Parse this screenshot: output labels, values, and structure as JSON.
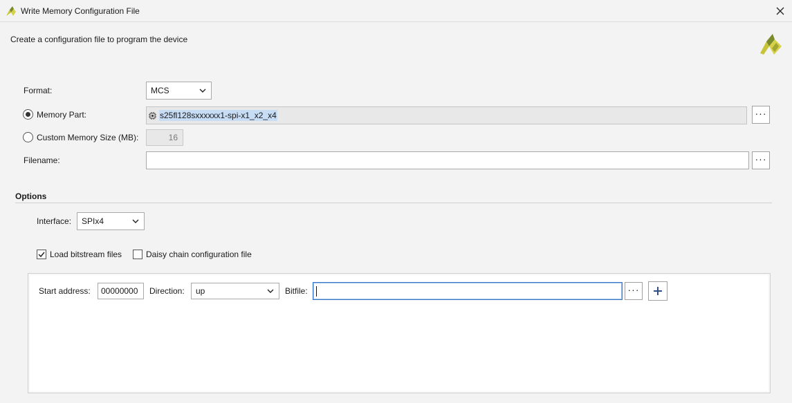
{
  "window": {
    "title": "Write Memory Configuration File",
    "close_icon": "close-icon",
    "app_icon": "vivado-logo-icon"
  },
  "header": {
    "description": "Create a configuration file to program the device",
    "brand_logo": "vivado-logo"
  },
  "form": {
    "format_label": "Format:",
    "format_value": "MCS",
    "memory_part_label": "Memory Part:",
    "memory_part_selected": true,
    "memory_part_value": "s25fl128sxxxxxx1-spi-x1_x2_x4",
    "custom_size_label": "Custom Memory Size (MB):",
    "custom_size_selected": false,
    "custom_size_value": "16",
    "filename_label": "Filename:",
    "filename_value": "",
    "browse_label": "···"
  },
  "options": {
    "section_title": "Options",
    "interface_label": "Interface:",
    "interface_value": "SPIx4",
    "load_bitstream_label": "Load bitstream files",
    "load_bitstream_checked": true,
    "daisy_chain_label": "Daisy chain configuration file",
    "daisy_chain_checked": false
  },
  "bitstream": {
    "start_address_label": "Start address:",
    "start_address_value": "00000000",
    "direction_label": "Direction:",
    "direction_value": "up",
    "bitfile_label": "Bitfile:",
    "bitfile_value": "",
    "browse_label": "···",
    "add_icon": "plus-icon"
  },
  "colors": {
    "accent_blue": "#3a78c3",
    "logo_yellow": "#c8c43a",
    "logo_green": "#7a8b2a"
  }
}
